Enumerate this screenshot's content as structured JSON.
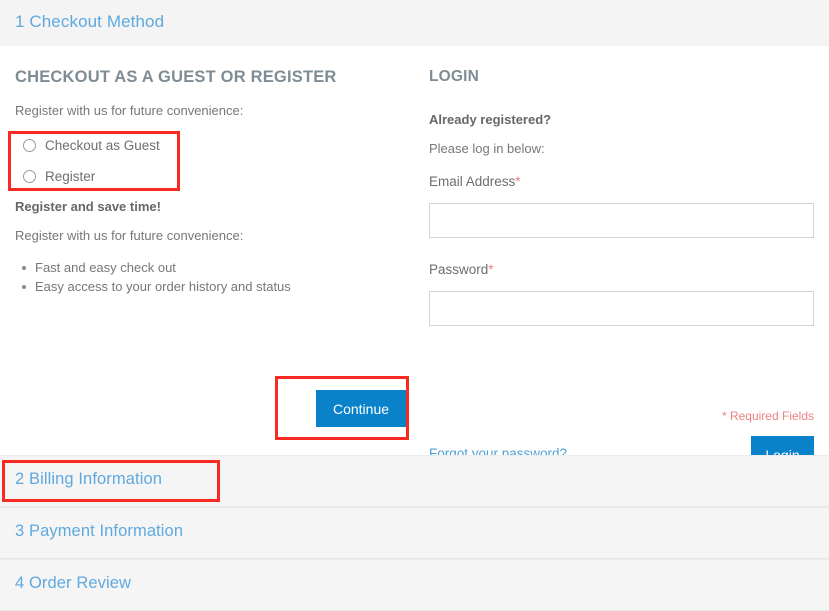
{
  "step_header": {
    "title": "1 Checkout Method"
  },
  "guest_section": {
    "heading": "CHECKOUT AS A GUEST OR REGISTER",
    "intro": "Register with us for future convenience:",
    "options": [
      {
        "label": "Checkout as Guest"
      },
      {
        "label": "Register"
      }
    ],
    "register_heading": "Register and save time!",
    "register_intro": "Register with us for future convenience:",
    "benefits": [
      "Fast and easy check out",
      "Easy access to your order history and status"
    ],
    "continue_label": "Continue"
  },
  "login_section": {
    "heading": "LOGIN",
    "already_registered": "Already registered?",
    "please_log_in": "Please log in below:",
    "email_label": "Email Address",
    "email_value": "",
    "email_placeholder": "",
    "password_label": "Password",
    "password_value": "",
    "password_placeholder": "",
    "required_marker": "*",
    "required_fields_note": "* Required Fields",
    "forgot_password_link": "Forgot your password?",
    "login_label": "Login"
  },
  "accordion": {
    "rows": [
      {
        "label": "2 Billing Information"
      },
      {
        "label": "3 Payment Information"
      },
      {
        "label": "4 Order Review"
      }
    ]
  },
  "annotations": {
    "colors": {
      "highlight": "#f92a23",
      "primary_button": "#0a82c9",
      "link_blue": "#5fa9de",
      "required_red": "#ee7d7d"
    }
  }
}
